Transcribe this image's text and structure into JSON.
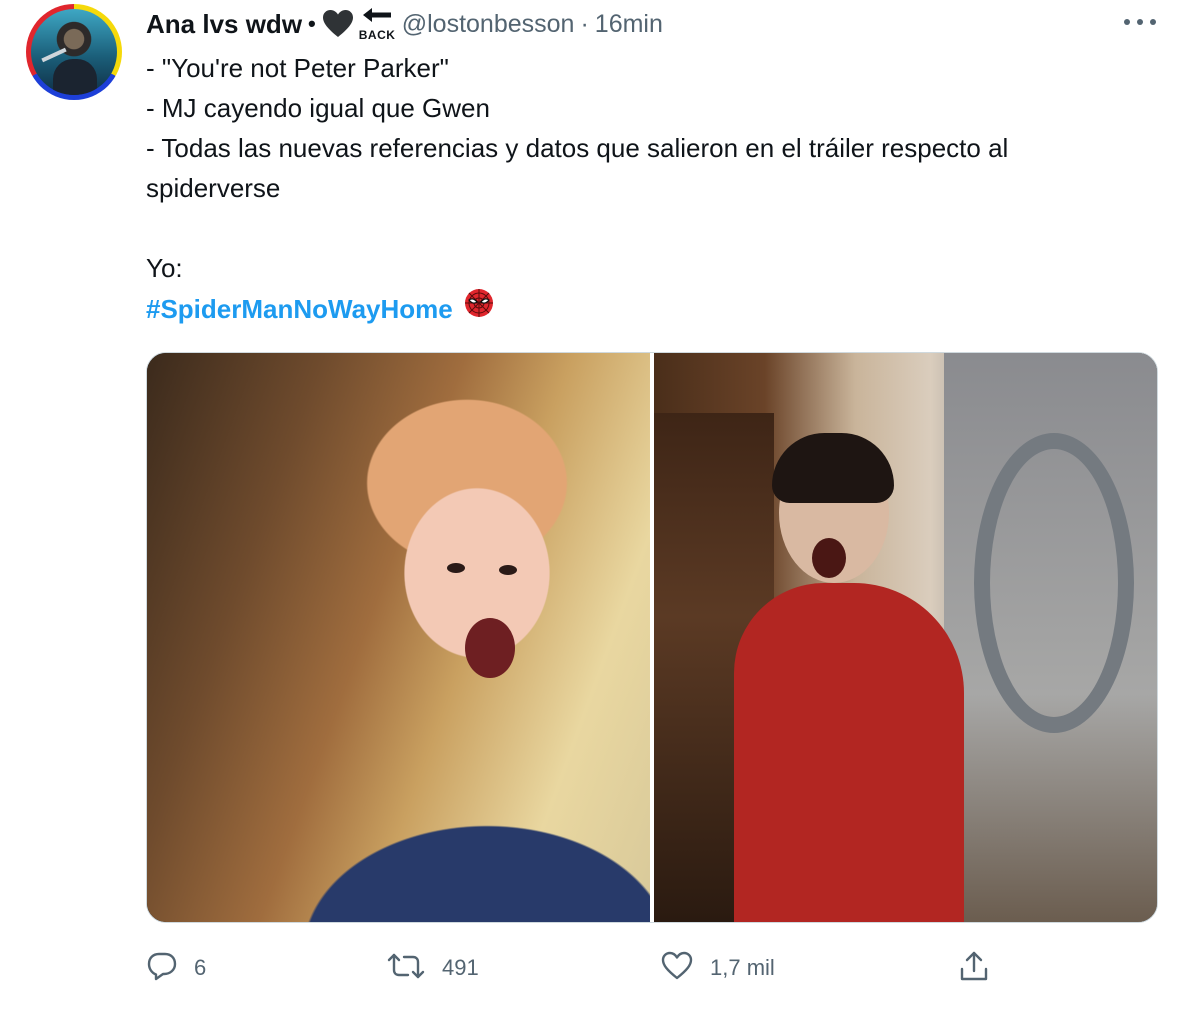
{
  "author": {
    "display_name": "Ana lvs wdw",
    "name_suffix_dot": "•",
    "badge_icons": [
      "heart-icon",
      "back-arrow-icon"
    ],
    "badge_back_text": "BACK",
    "handle": "@lostonbesson",
    "separator": "·",
    "time": "16min"
  },
  "tweet": {
    "lines": [
      "- \"You're not Peter Parker\"",
      "- MJ cayendo igual que Gwen",
      "- Todas las nuevas referencias y datos que salieron en el tráiler respecto al",
      "spiderverse"
    ],
    "lead_in": "Yo:",
    "hashtag": "#SpiderManNoWayHome",
    "hashtag_emoji": "spider-man-mask-icon"
  },
  "media": {
    "count": 2,
    "images": [
      "screaming-child-photo",
      "shocked-man-photo"
    ]
  },
  "actions": {
    "replies": "6",
    "retweets": "491",
    "likes": "1,7 mil"
  },
  "colors": {
    "text": "#0f1419",
    "secondary": "#536471",
    "link": "#1d9bf0",
    "border": "#cfd9de"
  }
}
